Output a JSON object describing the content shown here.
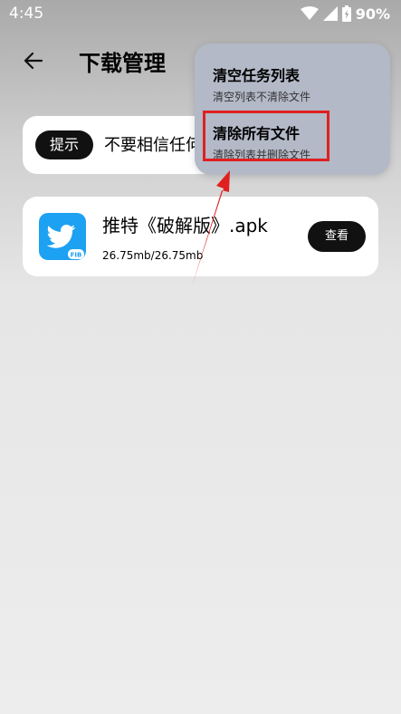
{
  "status_bar": {
    "time": "4:45",
    "battery": "90%",
    "icons": [
      "wifi-icon",
      "signal-icon",
      "battery-icon"
    ]
  },
  "header": {
    "back_icon": "arrow-left-icon",
    "title": "下载管理"
  },
  "notice": {
    "label": "提示",
    "text": "不要相信任何"
  },
  "download_item": {
    "icon": "twitter-app-icon",
    "name": "推特《破解版》.apk",
    "size": "26.75mb/26.75mb",
    "view_label": "查看"
  },
  "menu": {
    "items": [
      {
        "title": "清空任务列表",
        "subtitle": "清空列表不清除文件"
      },
      {
        "title": "清除所有文件",
        "subtitle": "清除列表并删除文件"
      }
    ]
  },
  "annotation": {
    "highlight_color": "#e02020",
    "arrow_color": "#e02020"
  },
  "colors": {
    "menu_bg": "#b3b9c7",
    "pill_bg": "#111111",
    "twitter_blue": "#1da1f2"
  }
}
